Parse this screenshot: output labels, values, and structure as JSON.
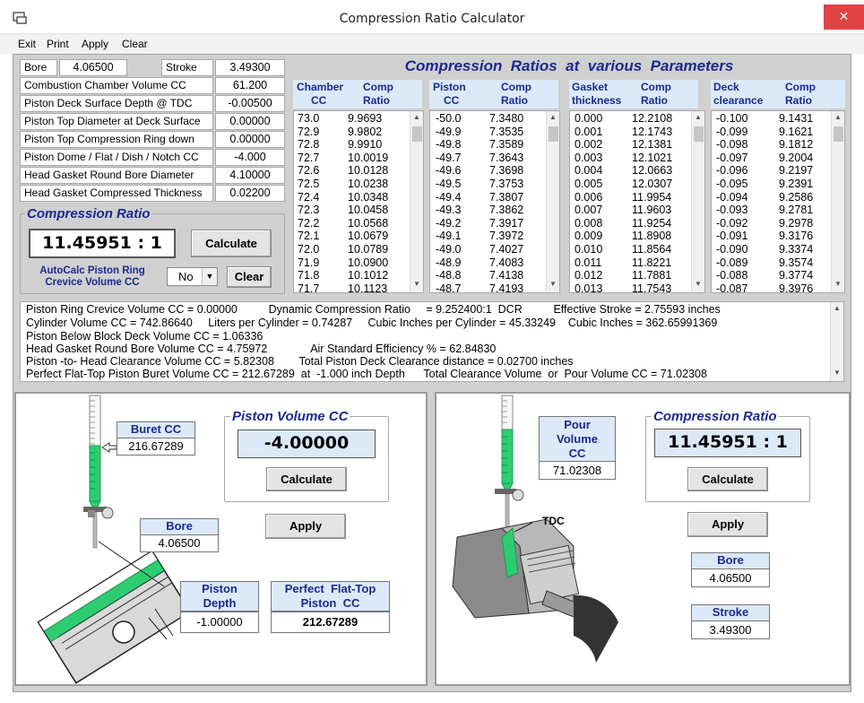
{
  "window": {
    "title": "Compression  Ratio  Calculator",
    "close_glyph": "✕"
  },
  "menu": {
    "items": [
      "Exit",
      "Print",
      "Apply",
      "Clear"
    ]
  },
  "inputs": {
    "bore_label": "Bore",
    "bore_value": "4.06500",
    "stroke_label": "Stroke",
    "stroke_value": "3.49300",
    "rows": [
      {
        "label": "Combustion Chamber Volume CC",
        "value": "61.200"
      },
      {
        "label": "Piston Deck Surface Depth  @  TDC",
        "value": "-0.00500"
      },
      {
        "label": "Piston Top Diameter at Deck Surface",
        "value": "0.00000"
      },
      {
        "label": "Piston Top Compression Ring down",
        "value": "0.00000"
      },
      {
        "label": "Piston Dome / Flat / Dish / Notch CC",
        "value": "-4.000"
      },
      {
        "label": "Head Gasket Round Bore Diameter",
        "value": "4.10000"
      },
      {
        "label": "Head Gasket Compressed Thickness",
        "value": "0.02200"
      }
    ]
  },
  "compression": {
    "title": "Compression Ratio",
    "value": "11.45951 : 1",
    "calc_label": "Calculate",
    "autocalc_label1": "AutoCalc Piston Ring",
    "autocalc_label2": "Crevice Volume CC",
    "select_value": "No",
    "clear_label": "Clear"
  },
  "params": {
    "title": "Compression  Ratios  at  various  Parameters",
    "tables": [
      {
        "h1a": "Chamber",
        "h1b": "CC",
        "h2a": "Comp",
        "h2b": "Ratio",
        "rows": [
          [
            "73.0",
            "9.9693"
          ],
          [
            "72.9",
            "9.9802"
          ],
          [
            "72.8",
            "9.9910"
          ],
          [
            "72.7",
            "10.0019"
          ],
          [
            "72.6",
            "10.0128"
          ],
          [
            "72.5",
            "10.0238"
          ],
          [
            "72.4",
            "10.0348"
          ],
          [
            "72.3",
            "10.0458"
          ],
          [
            "72.2",
            "10.0568"
          ],
          [
            "72.1",
            "10.0679"
          ],
          [
            "72.0",
            "10.0789"
          ],
          [
            "71.9",
            "10.0900"
          ],
          [
            "71.8",
            "10.1012"
          ],
          [
            "71.7",
            "10.1123"
          ]
        ]
      },
      {
        "h1a": "Piston",
        "h1b": "CC",
        "h2a": "Comp",
        "h2b": "Ratio",
        "rows": [
          [
            "-50.0",
            "7.3480"
          ],
          [
            "-49.9",
            "7.3535"
          ],
          [
            "-49.8",
            "7.3589"
          ],
          [
            "-49.7",
            "7.3643"
          ],
          [
            "-49.6",
            "7.3698"
          ],
          [
            "-49.5",
            "7.3753"
          ],
          [
            "-49.4",
            "7.3807"
          ],
          [
            "-49.3",
            "7.3862"
          ],
          [
            "-49.2",
            "7.3917"
          ],
          [
            "-49.1",
            "7.3972"
          ],
          [
            "-49.0",
            "7.4027"
          ],
          [
            "-48.9",
            "7.4083"
          ],
          [
            "-48.8",
            "7.4138"
          ],
          [
            "-48.7",
            "7.4193"
          ]
        ]
      },
      {
        "h1a": "Gasket",
        "h1b": "thickness",
        "h2a": "Comp",
        "h2b": "Ratio",
        "rows": [
          [
            "0.000",
            "12.2108"
          ],
          [
            "0.001",
            "12.1743"
          ],
          [
            "0.002",
            "12.1381"
          ],
          [
            "0.003",
            "12.1021"
          ],
          [
            "0.004",
            "12.0663"
          ],
          [
            "0.005",
            "12.0307"
          ],
          [
            "0.006",
            "11.9954"
          ],
          [
            "0.007",
            "11.9603"
          ],
          [
            "0.008",
            "11.9254"
          ],
          [
            "0.009",
            "11.8908"
          ],
          [
            "0.010",
            "11.8564"
          ],
          [
            "0.011",
            "11.8221"
          ],
          [
            "0.012",
            "11.7881"
          ],
          [
            "0.013",
            "11.7543"
          ]
        ]
      },
      {
        "h1a": "Deck",
        "h1b": "clearance",
        "h2a": "Comp",
        "h2b": "Ratio",
        "rows": [
          [
            "-0.100",
            "9.1431"
          ],
          [
            "-0.099",
            "9.1621"
          ],
          [
            "-0.098",
            "9.1812"
          ],
          [
            "-0.097",
            "9.2004"
          ],
          [
            "-0.096",
            "9.2197"
          ],
          [
            "-0.095",
            "9.2391"
          ],
          [
            "-0.094",
            "9.2586"
          ],
          [
            "-0.093",
            "9.2781"
          ],
          [
            "-0.092",
            "9.2978"
          ],
          [
            "-0.091",
            "9.3176"
          ],
          [
            "-0.090",
            "9.3374"
          ],
          [
            "-0.089",
            "9.3574"
          ],
          [
            "-0.088",
            "9.3774"
          ],
          [
            "-0.087",
            "9.3976"
          ]
        ]
      }
    ]
  },
  "info": {
    "lines": [
      "Piston Ring Crevice Volume CC = 0.00000          Dynamic Compression Ratio     = 9.252400:1  DCR          Effective Stroke = 2.75593 inches",
      "Cylinder Volume CC = 742.86640     Liters per Cylinder = 0.74287     Cubic Inches per Cylinder = 45.33249    Cubic Inches = 362.65991369",
      "Piston Below Block Deck Volume CC = 1.06336",
      "Head Gasket Round Bore Volume CC = 4.75972              Air Standard Efficiency % = 62.84830",
      "Piston -to- Head Clearance Volume CC = 5.82308        Total Piston Deck Clearance distance = 0.02700 inches",
      "Perfect Flat-Top Piston Buret Volume CC = 212.67289  at  -1.000 inch Depth      Total Clearance Volume  or  Pour Volume CC = 71.02308"
    ]
  },
  "left_panel": {
    "buret_label": "Buret CC",
    "buret_value": "216.67289",
    "piston_vol_title": "Piston Volume CC",
    "piston_vol_value": "-4.00000",
    "calc_label": "Calculate",
    "apply_label": "Apply",
    "bore_label": "Bore",
    "bore_value": "4.06500",
    "depth_label1": "Piston",
    "depth_label2": "Depth",
    "depth_value": "-1.00000",
    "flat_label1": "Perfect  Flat-Top",
    "flat_label2": "Piston  CC",
    "flat_value": "212.67289"
  },
  "right_panel": {
    "pour_label1": "Pour",
    "pour_label2": "Volume",
    "pour_label3": "CC",
    "pour_value": "71.02308",
    "tdc_label": "TDC",
    "cr_title": "Compression Ratio",
    "cr_value": "11.45951 : 1",
    "calc_label": "Calculate",
    "apply_label": "Apply",
    "bore_label": "Bore",
    "bore_value": "4.06500",
    "stroke_label": "Stroke",
    "stroke_value": "3.49300"
  },
  "colors": {
    "accent": "#1b2a8f",
    "header_bg": "#dbe9f8",
    "liquid": "#2ecc71",
    "close": "#e04343"
  }
}
